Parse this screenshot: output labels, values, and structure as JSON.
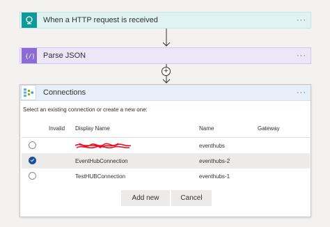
{
  "steps": [
    {
      "label": "When a HTTP request is received",
      "icon": "http-request-icon",
      "more": "···"
    },
    {
      "label": "Parse JSON",
      "icon": "parse-json-icon",
      "more": "···"
    }
  ],
  "connections": {
    "title": "Connections",
    "icon": "event-hubs-icon",
    "more": "···",
    "subtitle": "Select an existing connection or create a new one:",
    "columns": {
      "invalid": "Invalid",
      "display_name": "Display Name",
      "name": "Name",
      "gateway": "Gateway"
    },
    "rows": [
      {
        "display_name": "",
        "name": "eventhubs",
        "selected": false,
        "redacted": true
      },
      {
        "display_name": "EventHubConnection",
        "name": "eventhubs-2",
        "selected": true
      },
      {
        "display_name": "TestHUBConnection",
        "name": "eventhubs-1",
        "selected": false
      }
    ],
    "add_new": "Add new",
    "cancel": "Cancel"
  },
  "colors": {
    "trigger": "#0f9a9a",
    "parse_json": "#8b6cd6",
    "selected_radio": "#1b4fa0"
  }
}
